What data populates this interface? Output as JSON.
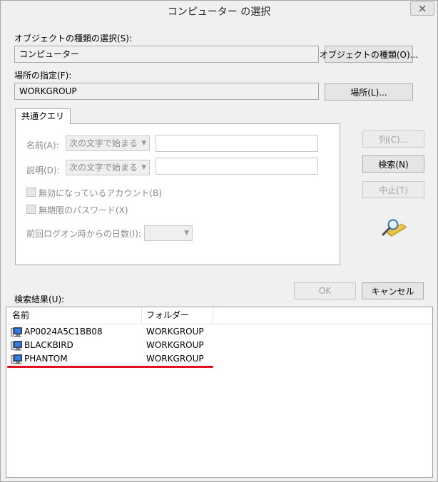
{
  "window": {
    "title": "コンピューター の選択"
  },
  "object_type": {
    "label": "オブジェクトの種類の選択(S):",
    "value": "コンピューター",
    "button": "オブジェクトの種類(O)..."
  },
  "location": {
    "label": "場所の指定(F):",
    "value": "WORKGROUP",
    "button": "場所(L)..."
  },
  "common_query": {
    "tab": "共通クエリ",
    "name_label": "名前(A):",
    "name_mode": "次の文字で始まる",
    "name_value": "",
    "desc_label": "説明(D):",
    "desc_mode": "次の文字で始まる",
    "desc_value": "",
    "disabled_accounts": "無効になっているアカウント(B)",
    "no_expire_password": "無期限のパスワード(X)",
    "days_since_logon_label": "前回ログオン時からの日数(I):",
    "days_since_logon_value": ""
  },
  "side_buttons": {
    "columns": "列(C)...",
    "search": "検索(N)",
    "stop": "中止(T)"
  },
  "dialog_buttons": {
    "ok": "OK",
    "cancel": "キャンセル"
  },
  "results": {
    "label": "検索結果(U):",
    "columns": [
      "名前",
      "フォルダー"
    ],
    "rows": [
      {
        "name": "AP0024A5C1BB08",
        "folder": "WORKGROUP"
      },
      {
        "name": "BLACKBIRD",
        "folder": "WORKGROUP"
      },
      {
        "name": "PHANTOM",
        "folder": "WORKGROUP"
      }
    ]
  },
  "colors": {
    "annotation_underline": "#e0101e"
  },
  "icons": {
    "search_graphic": "magnifier-over-directory-icon",
    "row_icon": "computer-icon"
  }
}
